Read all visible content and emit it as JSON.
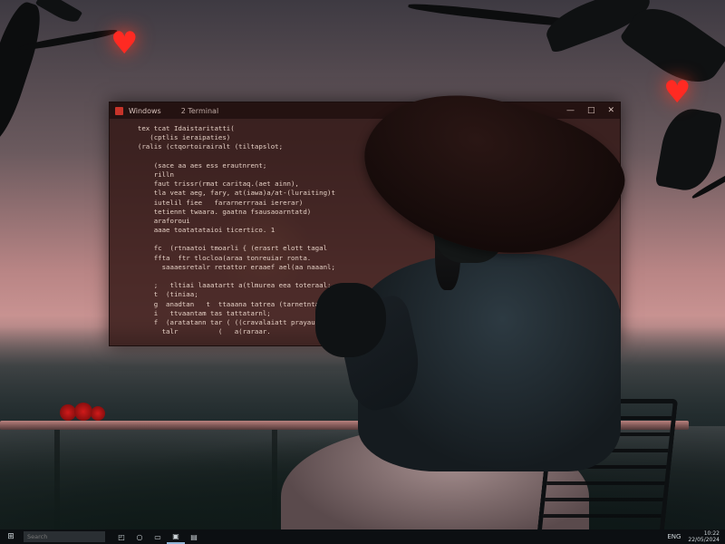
{
  "window": {
    "title": "Windows",
    "tab_label": "2 Terminal",
    "controls": {
      "minimize": "—",
      "maximize": "□",
      "close": "✕"
    },
    "icon": "terminal-icon"
  },
  "terminal": {
    "lines": [
      "  tex tcat Idaistaritatti(",
      "     (cptlis ieraipaties)",
      "  (ralis (ctqortoirairalt (tiltapslot;",
      "",
      "      (sace aa aes ess erautnrent;",
      "      rilln",
      "      faut trissr(rmat caritaq.(aet ainn),",
      "      tla veat aeg, fary, at(iawa)a/at-(luraiting)t",
      "      iutelil fiee   fararnerrraai iererar)",
      "      tetiennt twaara. gaatna fsausaoarntatd)",
      "      araforoui",
      "      aaae toatatataioi ticertico. 1",
      "",
      "      fc  (rtnaatoi tmoarli { (erasrt elott tagal",
      "      ffta  ftr tlocloa(araa tonreuiar ronta.",
      "        saaaesretalr retattor eraaef ael(aa naaanl;",
      "",
      "      ;   tltiai laaatartt a(tlmurea eea toteraal;",
      "      t  (tiniaa;",
      "      g  anadtan   t  ttaaana tatrea (tarnetntar;",
      "      i   ttvaantam tas tattatarnl;",
      "      f  (aratatann tar ( ((cravalaiatt prayaur;",
      "        talr          (   a(raraar."
    ]
  },
  "taskbar": {
    "start_icon": "windows-logo-icon",
    "start_glyph": "⊞",
    "search_placeholder": "Search",
    "apps": [
      {
        "name": "task-view-icon",
        "glyph": "◰"
      },
      {
        "name": "search-app-icon",
        "glyph": "○"
      },
      {
        "name": "file-explorer-icon",
        "glyph": "▭"
      },
      {
        "name": "terminal-app-icon",
        "glyph": "▣"
      },
      {
        "name": "notes-app-icon",
        "glyph": "▤"
      }
    ],
    "tray_label": "ENG",
    "clock_time": "10:22",
    "clock_date": "22/05/2024"
  }
}
